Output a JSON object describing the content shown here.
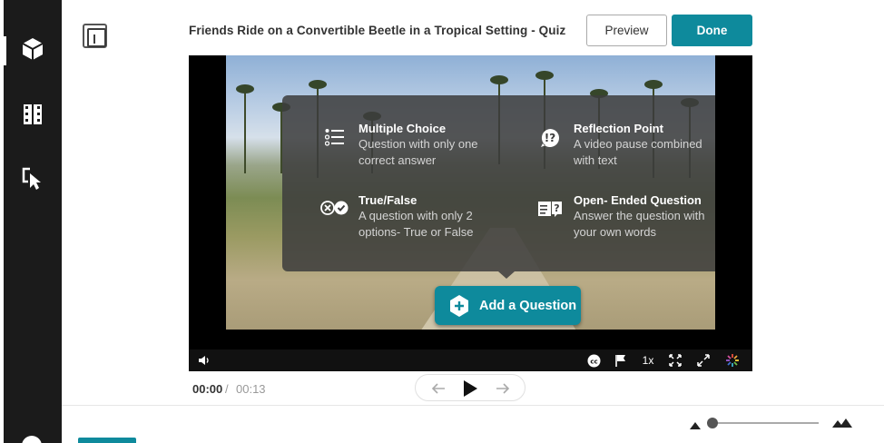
{
  "header": {
    "title": "Friends Ride on a Convertible Beetle in a Tropical Setting - Quiz",
    "preview_label": "Preview",
    "done_label": "Done"
  },
  "sidebar": {
    "items": [
      {
        "icon": "cube-icon",
        "active": true
      },
      {
        "icon": "film-strip-icon",
        "active": false
      },
      {
        "icon": "cursor-click-icon",
        "active": false
      }
    ]
  },
  "question_menu": {
    "options": [
      {
        "title": "Multiple Choice",
        "line1": "Question with only one",
        "line2": "correct answer",
        "icon": "list-icon"
      },
      {
        "title": "Reflection Point",
        "line1": "A video pause combined",
        "line2": "with text",
        "icon": "question-bubble-icon"
      },
      {
        "title": "True/False",
        "line1": "A question with only 2",
        "line2": "options- True or False",
        "icon": "true-false-icon"
      },
      {
        "title": "Open- Ended Question",
        "line1": "Answer the question with",
        "line2": "your own words",
        "icon": "open-question-icon"
      }
    ],
    "add_label": "Add a Question"
  },
  "player": {
    "speed": "1x",
    "current_time": "00:00",
    "separator": "/",
    "duration": "00:13"
  },
  "colors": {
    "accent": "#0e8a9c",
    "rail": "#1b1b1b"
  }
}
